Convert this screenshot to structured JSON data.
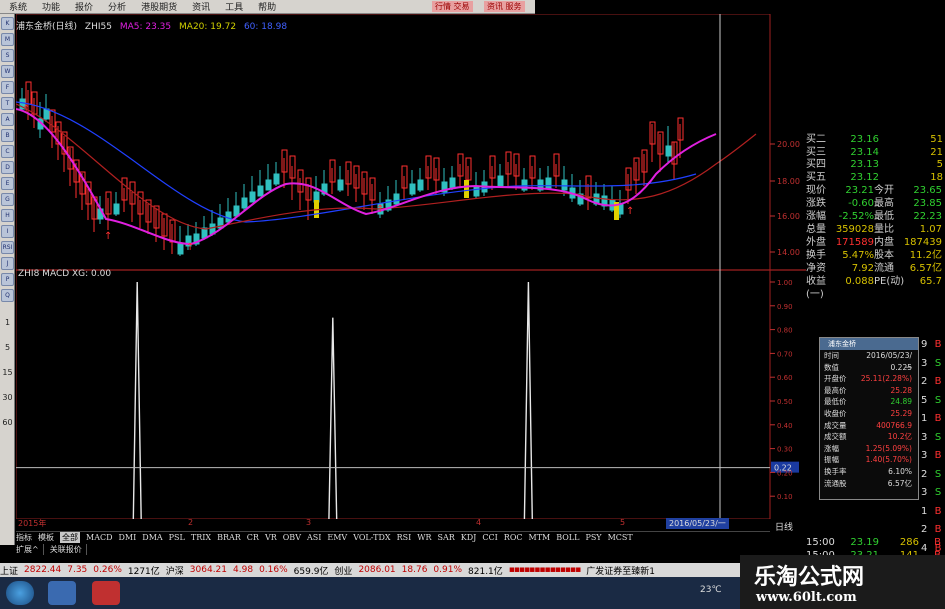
{
  "menu": {
    "items": [
      "系统",
      "功能",
      "报价",
      "分析",
      "港股期货",
      "资讯",
      "工具",
      "帮助"
    ],
    "extra_labels": [
      "行情 交易",
      "资讯 服务"
    ]
  },
  "toolbar": {
    "buttons": [
      "K",
      "M",
      "S",
      "W",
      "F",
      "T",
      "A",
      "B",
      "C",
      "D",
      "E",
      "G",
      "H",
      "I",
      "RSI",
      "J",
      "P",
      "Q"
    ],
    "numbers": [
      "1",
      "5",
      "15",
      "30",
      "60"
    ]
  },
  "legend": {
    "security": "浦东金桥(日线)",
    "indicator": "ZHI55",
    "ma5_label": "MA5: 23.35",
    "ma20_label": "MA20: 19.72",
    "ma60_label": "60: 18.98",
    "sub_indicator": "ZHI8 MACD XG: 0.00",
    "colors": {
      "ma5": "#e020e0",
      "ma20": "#d0d000",
      "ma60": "#2040ff",
      "up": "#ff3030",
      "down": "#30c0c0",
      "bg": "#000000"
    }
  },
  "chart_data": {
    "type": "line",
    "title": "ZHI8 MACD XG: 0.00",
    "xlabel": "",
    "ylabel": "",
    "x_tick_labels": [
      "2015年",
      "2",
      "3",
      "4",
      "5",
      "2016/05/23/一"
    ],
    "ylim": [
      0,
      1
    ],
    "y_tick_labels": [
      "1.00",
      "0.90",
      "0.80",
      "0.70",
      "0.60",
      "0.50",
      "0.40",
      "0.30",
      "0.20",
      "0.10"
    ],
    "signal_level": "0.22",
    "series": [
      {
        "name": "XG",
        "x": [
          0,
          30,
          31,
          32,
          80,
          81,
          82,
          130,
          131,
          132,
          180
        ],
        "values": [
          0,
          0,
          1,
          0,
          0,
          0.85,
          0,
          0,
          1,
          0,
          0
        ]
      }
    ],
    "price_axis_labels": [
      "20.00",
      "18.00",
      "16.00",
      "14.00"
    ]
  },
  "quote": {
    "bids": [
      {
        "label": "买二",
        "price": "23.16",
        "qty": "51"
      },
      {
        "label": "买三",
        "price": "23.14",
        "qty": "21"
      },
      {
        "label": "买四",
        "price": "23.13",
        "qty": "5"
      },
      {
        "label": "买五",
        "price": "23.12",
        "qty": "18"
      }
    ],
    "fields": [
      [
        "现价",
        "23.21",
        "今开",
        "23.65"
      ],
      [
        "涨跌",
        "-0.60",
        "最高",
        "23.85"
      ],
      [
        "涨幅",
        "-2.52%",
        "最低",
        "22.23"
      ],
      [
        "总量",
        "359028",
        "量比",
        "1.07"
      ],
      [
        "外盘",
        "171589",
        "内盘",
        "187439"
      ],
      [
        "换手",
        "5.47%",
        "股本",
        "11.2亿"
      ],
      [
        "净资",
        "7.92",
        "流通",
        "6.57亿"
      ],
      [
        "收益(一)",
        "0.088",
        "PE(动)",
        "65.7"
      ]
    ]
  },
  "popup": {
    "title": "浦东金桥",
    "rows": [
      [
        "时间",
        "2016/05/23/一"
      ],
      [
        "数值",
        "0.225"
      ],
      [
        "开盘价",
        "25.11(2.28%)"
      ],
      [
        "最高价",
        "25.28"
      ],
      [
        "最低价",
        "24.89"
      ],
      [
        "收盘价",
        "25.29"
      ],
      [
        "成交量",
        "400766.9"
      ],
      [
        "成交额",
        "10.2亿"
      ],
      [
        "涨幅",
        "1.25(5.09%)"
      ],
      [
        "振幅",
        "1.40(5.70%)"
      ],
      [
        "换手率",
        "6.10%"
      ],
      [
        "流通股",
        "6.57亿"
      ]
    ]
  },
  "side_flags": [
    [
      "9",
      "B"
    ],
    [
      "3",
      "S"
    ],
    [
      "2",
      "B"
    ],
    [
      "5",
      "S"
    ],
    [
      "1",
      "B"
    ],
    [
      "3",
      "S"
    ],
    [
      "3",
      "B"
    ],
    [
      "2",
      "S"
    ],
    [
      "3",
      "S"
    ],
    [
      "1",
      "B"
    ],
    [
      "2",
      "B"
    ],
    [
      "4",
      "B"
    ]
  ],
  "trades": [
    {
      "time": "15:00",
      "price": "23.19",
      "vol": "286",
      "flag": "B"
    },
    {
      "time": "15:00",
      "price": "23.21",
      "vol": "141",
      "flag": "B"
    }
  ],
  "period_label": "日线",
  "tabs": [
    "指标",
    "模板",
    "全部",
    "MACD",
    "DMI",
    "DMA",
    "PSL",
    "TRIX",
    "BRAR",
    "CR",
    "VR",
    "OBV",
    "ASI",
    "EMV",
    "VOL-TDX",
    "RSI",
    "WR",
    "SAR",
    "KDJ",
    "CCI",
    "ROC",
    "MTM",
    "BOLL",
    "PSY",
    "MCST"
  ],
  "tabs2": [
    "扩展^",
    "关联报价"
  ],
  "status": {
    "sh_label": "上证",
    "sh_index": "2822.44",
    "sh_change": "7.35",
    "sh_pct": "0.26%",
    "sh_amount": "1271亿",
    "hs_label": "沪深",
    "hs_index": "3064.21",
    "hs_change": "4.98",
    "hs_pct": "0.16%",
    "hs_amount": "659.9亿",
    "cy_label": "创业",
    "cy_index": "2086.01",
    "cy_change": "18.76",
    "cy_pct": "0.91%",
    "cy_amount": "821.1亿",
    "broker": "广发证券至臻新1"
  },
  "taskbar": {
    "temp": "23℃"
  },
  "watermark": {
    "title": "乐淘公式网",
    "url": "www.60lt.com"
  }
}
